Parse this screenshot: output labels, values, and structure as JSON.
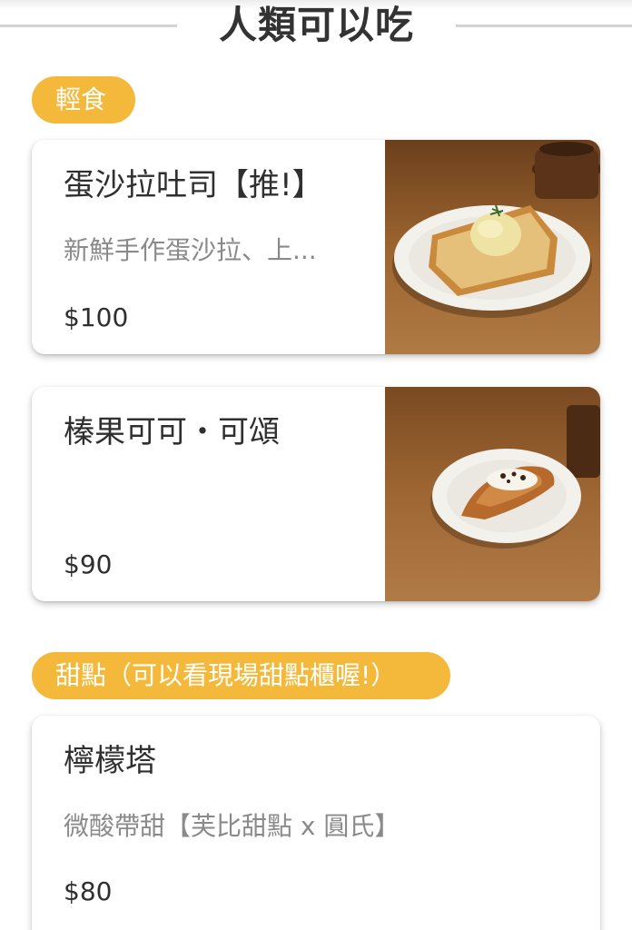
{
  "page": {
    "title": "人類可以吃"
  },
  "categories": [
    {
      "label": "輕食",
      "items": [
        {
          "name": "蛋沙拉吐司【推!】",
          "description": "新鮮手作蛋沙拉、上...",
          "price": "$100",
          "image_icon": "egg-salad-toast-photo"
        },
        {
          "name": "榛果可可・可頌",
          "description": "",
          "price": "$90",
          "image_icon": "hazelnut-cocoa-croissant-photo"
        }
      ]
    },
    {
      "label": "甜點（可以看現場甜點櫃喔!）",
      "items": [
        {
          "name": "檸檬塔",
          "description": "微酸帶甜【芙比甜點 x 圓氏】",
          "price": "$80"
        }
      ]
    }
  ],
  "colors": {
    "pill": "#f4b93a",
    "wood": "#8a5528"
  }
}
